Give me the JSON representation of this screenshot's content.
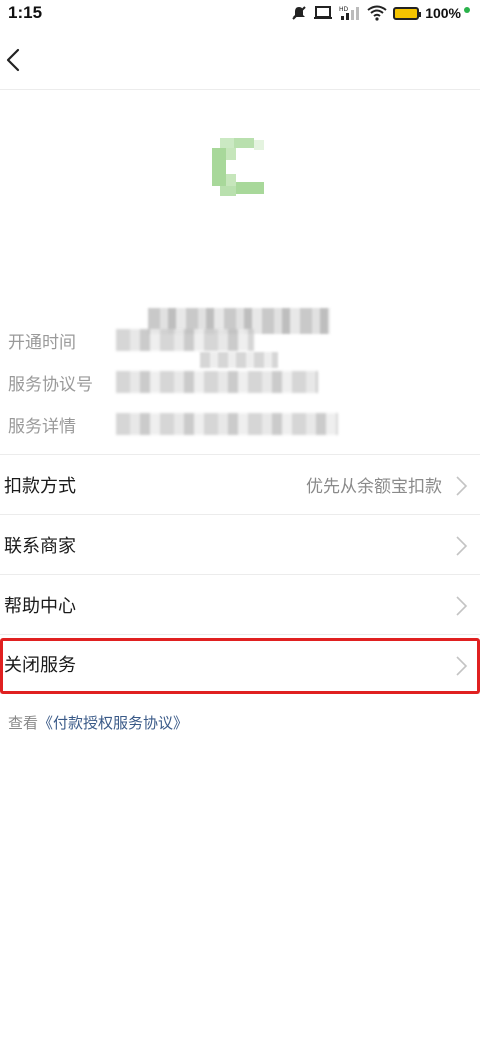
{
  "status_bar": {
    "time": "1:15",
    "battery_text": "100%",
    "icons": [
      "mute-icon",
      "laptop-icon",
      "hd-signal-icon",
      "wifi-icon",
      "battery-icon"
    ],
    "battery_color": "#f5c400",
    "dot_color": "#2ab24b"
  },
  "nav": {
    "back_icon": "chevron-left-icon"
  },
  "info_rows": [
    {
      "label": "开通时间"
    },
    {
      "label": "服务协议号"
    },
    {
      "label": "服务详情"
    }
  ],
  "menu": {
    "payment_method_label": "扣款方式",
    "payment_method_value": "优先从余额宝扣款",
    "contact_merchant_label": "联系商家",
    "help_center_label": "帮助中心",
    "close_service_label": "关闭服务"
  },
  "agreement": {
    "prefix": "查看",
    "link": "《付款授权服务协议》"
  },
  "colors": {
    "highlight": "#e02020",
    "logo_green": "#a8d89a",
    "link": "#3a5a88"
  }
}
